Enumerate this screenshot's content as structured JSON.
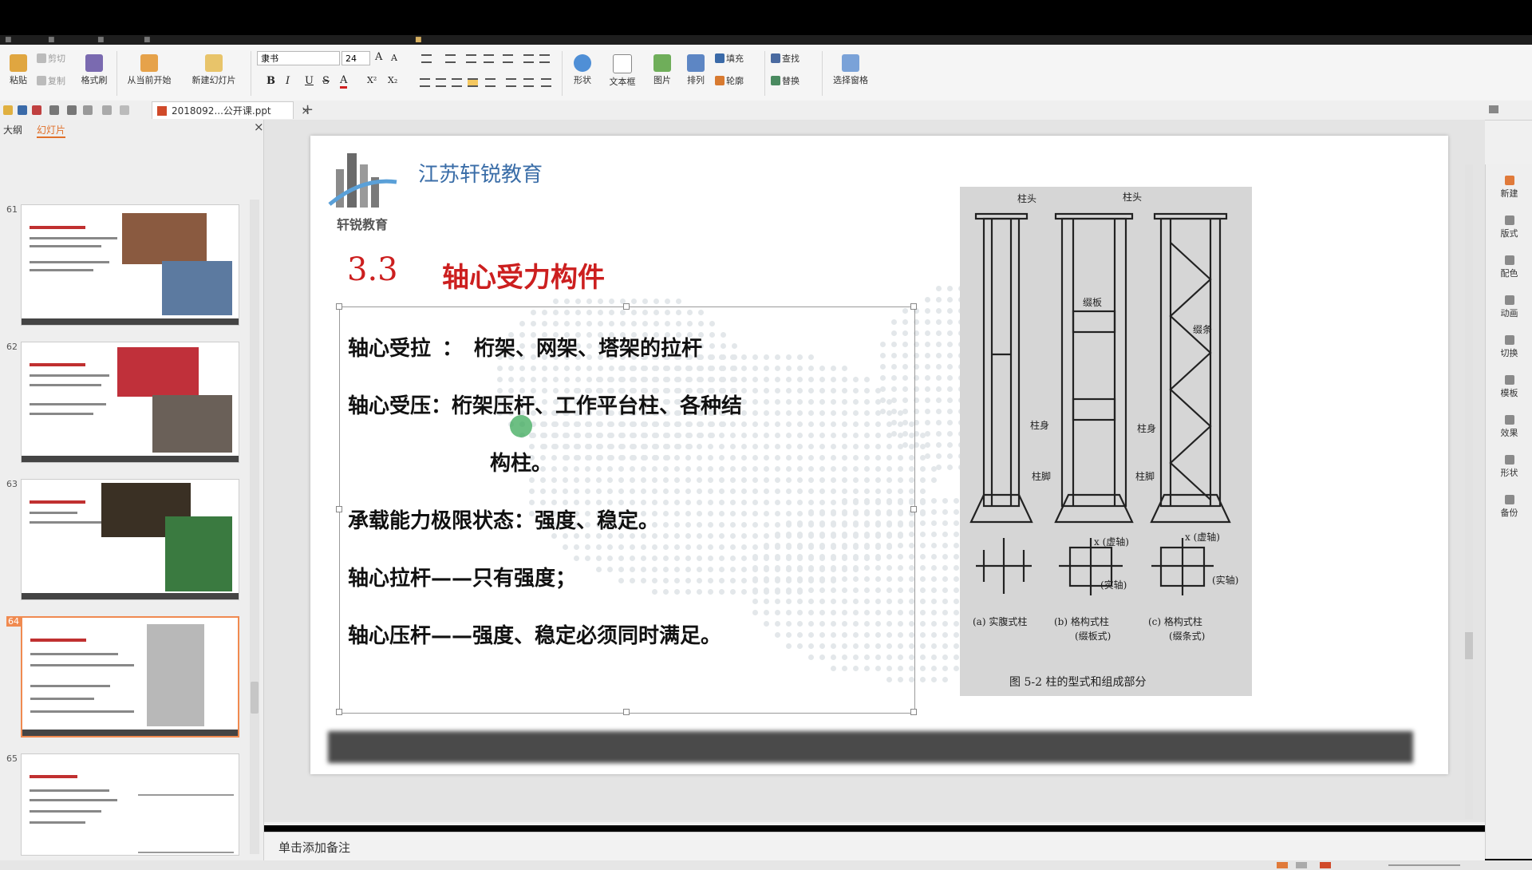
{
  "ribbon": {
    "paste": "粘贴",
    "cut": "剪切",
    "copy": "复制",
    "format_painter": "格式刷",
    "from_start": "从当前开始",
    "new_slide": "新建幻灯片",
    "font_name": "隶书",
    "font_size": "24",
    "bold": "B",
    "italic": "I",
    "underline": "U",
    "strike": "S",
    "font_color": "A",
    "superscript": "X²",
    "subscript": "X₂",
    "shape": "形状",
    "textbox": "文本框",
    "picture": "图片",
    "arrange": "排列",
    "fill": "填充",
    "outline": "轮廓",
    "find": "查找",
    "replace": "替换",
    "select_pane": "选择窗格"
  },
  "document_tab": {
    "title": "2018092...公开课.ppt"
  },
  "left_panel": {
    "tab_outline": "大纲",
    "tab_slides": "幻灯片",
    "slide_numbers": [
      "61",
      "62",
      "63",
      "64",
      "65"
    ],
    "selected": "64"
  },
  "slide": {
    "org_name": "江苏轩锐教育",
    "logo_text": "轩锐教育",
    "title_number": "3.3",
    "title_text": "轴心受力构件",
    "body": {
      "line1_label": "轴心受拉",
      "line1_sep": "：",
      "line1_text": "桁架、网架、塔架的拉杆",
      "line2_label": "轴心受压：",
      "line2_text": "桁架压杆、工作平台柱、各种结",
      "line2_cont": "构柱。",
      "line3": "承载能力极限状态：强度、稳定。",
      "line4": "轴心拉杆——只有强度；",
      "line5": "轴心压杆——强度、稳定必须同时满足。"
    },
    "figure": {
      "caption": "图 5-2   柱的型式和组成部分",
      "col_head": "柱头",
      "col_body": "柱身",
      "col_foot": "柱脚",
      "batten": "缀板",
      "lacing": "缀条",
      "label_a": "(a) 实腹式柱",
      "label_b": "(b) 格构式柱",
      "label_b2": "(缀板式)",
      "label_c": "(c) 格构式柱",
      "label_c2": "(缀条式)",
      "virtual_axis": "x (虚轴)",
      "real_axis": "(实轴)"
    }
  },
  "notes": {
    "placeholder": "单击添加备注"
  },
  "right_rail": {
    "items": [
      "新建",
      "版式",
      "配色",
      "动画",
      "切换",
      "模板",
      "效果",
      "形状",
      "备份"
    ]
  },
  "colors": {
    "title_red": "#cc1f1f",
    "org_blue": "#3b6ea8",
    "accent_orange": "#f08a50"
  }
}
